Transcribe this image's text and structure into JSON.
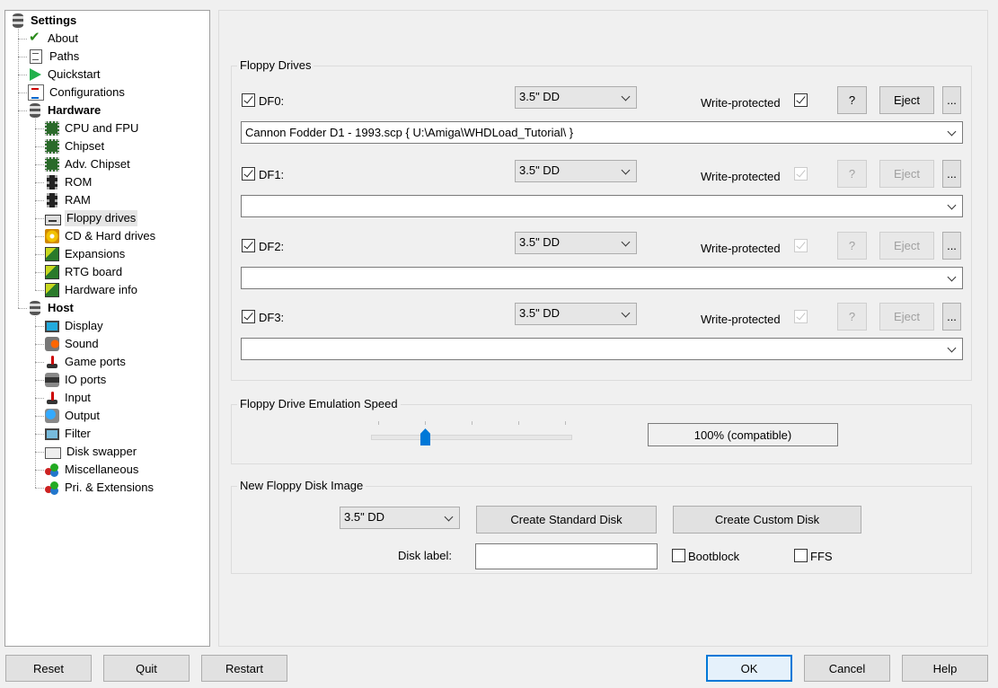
{
  "tree": {
    "items": [
      {
        "label": "Settings",
        "icon": "settings-icon",
        "bold": true,
        "level": 0
      },
      {
        "label": "About",
        "icon": "about-icon",
        "level": 1
      },
      {
        "label": "Paths",
        "icon": "paths-icon",
        "level": 1
      },
      {
        "label": "Quickstart",
        "icon": "quickstart-icon",
        "level": 1
      },
      {
        "label": "Configurations",
        "icon": "configurations-icon",
        "level": 1
      },
      {
        "label": "Hardware",
        "icon": "hardware-icon",
        "bold": true,
        "level": 1
      },
      {
        "label": "CPU and FPU",
        "icon": "cpu-icon",
        "level": 2
      },
      {
        "label": "Chipset",
        "icon": "chipset-icon",
        "level": 2
      },
      {
        "label": "Adv. Chipset",
        "icon": "adv-chipset-icon",
        "level": 2
      },
      {
        "label": "ROM",
        "icon": "rom-icon",
        "level": 2
      },
      {
        "label": "RAM",
        "icon": "ram-icon",
        "level": 2
      },
      {
        "label": "Floppy drives",
        "icon": "floppy-icon",
        "level": 2,
        "selected": true
      },
      {
        "label": "CD & Hard drives",
        "icon": "cd-icon",
        "level": 2
      },
      {
        "label": "Expansions",
        "icon": "expansions-icon",
        "level": 2
      },
      {
        "label": "RTG board",
        "icon": "rtg-icon",
        "level": 2
      },
      {
        "label": "Hardware info",
        "icon": "hardware-info-icon",
        "level": 2
      },
      {
        "label": "Host",
        "icon": "host-icon",
        "bold": true,
        "level": 1
      },
      {
        "label": "Display",
        "icon": "display-icon",
        "level": 2
      },
      {
        "label": "Sound",
        "icon": "sound-icon",
        "level": 2
      },
      {
        "label": "Game ports",
        "icon": "game-ports-icon",
        "level": 2
      },
      {
        "label": "IO ports",
        "icon": "io-ports-icon",
        "level": 2
      },
      {
        "label": "Input",
        "icon": "input-icon",
        "level": 2
      },
      {
        "label": "Output",
        "icon": "output-icon",
        "level": 2
      },
      {
        "label": "Filter",
        "icon": "filter-icon",
        "level": 2
      },
      {
        "label": "Disk swapper",
        "icon": "disk-swapper-icon",
        "level": 2
      },
      {
        "label": "Miscellaneous",
        "icon": "misc-icon",
        "level": 2
      },
      {
        "label": "Pri. & Extensions",
        "icon": "extensions-icon",
        "level": 2
      }
    ]
  },
  "floppy": {
    "group_title": "Floppy Drives",
    "write_protected_label": "Write-protected",
    "help_label": "?",
    "eject_label": "Eject",
    "more_label": "...",
    "drives": [
      {
        "name": "DF0:",
        "enabled": true,
        "type": "3.5\" DD",
        "write_protected": true,
        "path": "Cannon Fodder D1 - 1993.scp { U:\\Amiga\\WHDLoad_Tutorial\\ }",
        "has_disk": true
      },
      {
        "name": "DF1:",
        "enabled": true,
        "type": "3.5\" DD",
        "write_protected": true,
        "path": "",
        "has_disk": false
      },
      {
        "name": "DF2:",
        "enabled": true,
        "type": "3.5\" DD",
        "write_protected": true,
        "path": "",
        "has_disk": false
      },
      {
        "name": "DF3:",
        "enabled": true,
        "type": "3.5\" DD",
        "write_protected": true,
        "path": "",
        "has_disk": false
      }
    ]
  },
  "speed": {
    "group_title": "Floppy Drive Emulation Speed",
    "value_label": "100% (compatible)",
    "slider_position": 0.27
  },
  "new_disk": {
    "group_title": "New Floppy Disk Image",
    "type": "3.5\" DD",
    "create_standard_label": "Create Standard Disk",
    "create_custom_label": "Create Custom Disk",
    "disk_label_caption": "Disk label:",
    "disk_label_value": "",
    "bootblock_label": "Bootblock",
    "bootblock_checked": false,
    "ffs_label": "FFS",
    "ffs_checked": false
  },
  "footer": {
    "reset": "Reset",
    "quit": "Quit",
    "restart": "Restart",
    "ok": "OK",
    "cancel": "Cancel",
    "help": "Help"
  },
  "colors": {
    "accent": "#0078d7",
    "background": "#f0f0f0"
  }
}
